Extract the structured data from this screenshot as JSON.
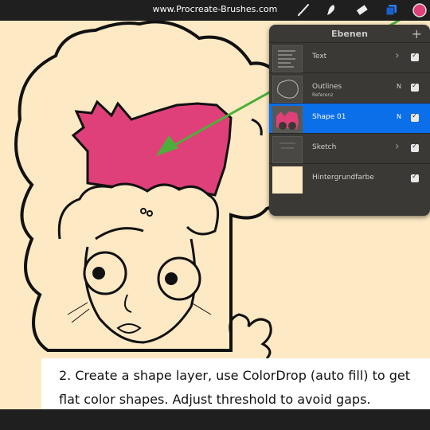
{
  "topbar": {
    "site_label": "www.Procreate-Brushes.com",
    "tools": [
      {
        "icon": "brush-icon"
      },
      {
        "icon": "smudge-icon"
      },
      {
        "icon": "eraser-icon"
      },
      {
        "icon": "layers-icon"
      },
      {
        "icon": "color-swatch-icon",
        "color": "#e0407a"
      }
    ]
  },
  "layers_panel": {
    "title": "Ebenen",
    "add_label": "+",
    "layers": [
      {
        "name": "Text",
        "mode": "",
        "subtitle": "",
        "group": true,
        "visible": true,
        "active": false
      },
      {
        "name": "Outlines",
        "mode": "N",
        "subtitle": "Referenz",
        "group": false,
        "visible": true,
        "active": false
      },
      {
        "name": "Shape 01",
        "mode": "N",
        "subtitle": "",
        "group": false,
        "visible": true,
        "active": true
      },
      {
        "name": "Sketch",
        "mode": "",
        "subtitle": "",
        "group": true,
        "visible": true,
        "active": false
      },
      {
        "name": "Hintergrundfarbe",
        "mode": "",
        "subtitle": "",
        "group": false,
        "visible": true,
        "active": false
      }
    ]
  },
  "caption": {
    "line1": "2. Create a shape layer, use ColorDrop (auto fill) to get",
    "line2": "flat color shapes. Adjust threshold to avoid gaps."
  },
  "colors": {
    "canvas_bg": "#fde9c4",
    "shape_fill": "#e0407a",
    "arrow": "#4caf3a",
    "active_layer": "#0a6fe8"
  }
}
